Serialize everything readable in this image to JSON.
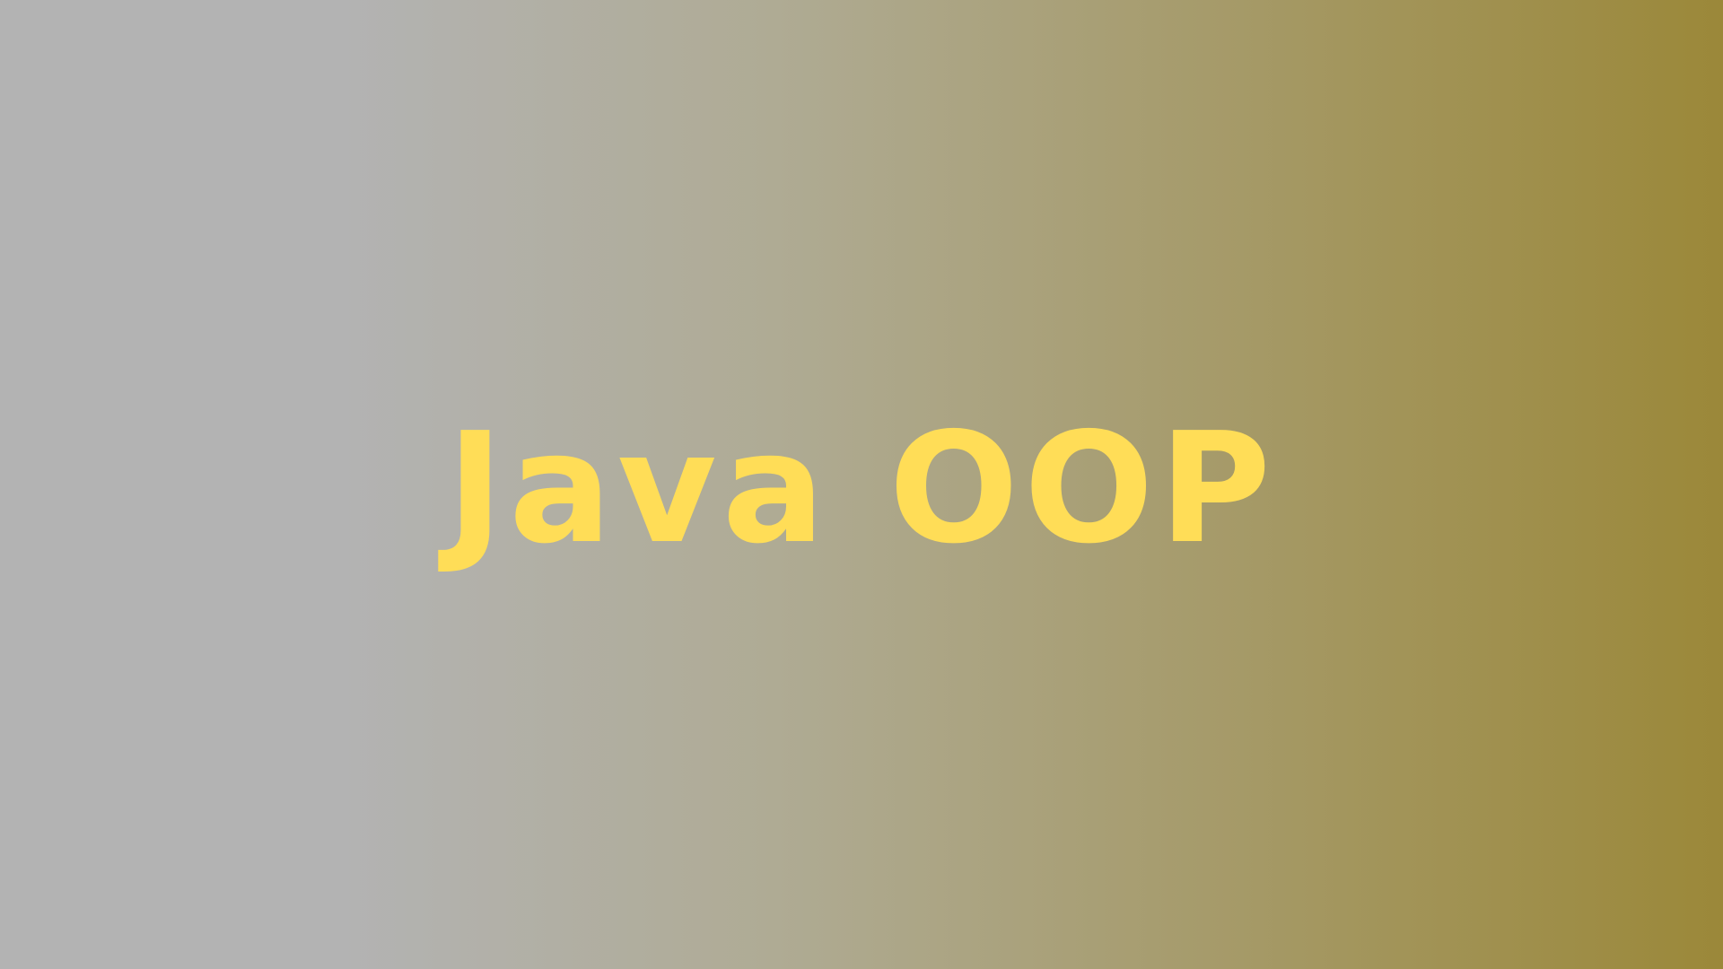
{
  "slide": {
    "title": "Java OOP",
    "colors": {
      "title": "#ffdd57",
      "background_left": "#b3b3b3",
      "background_right": "#9b8839"
    }
  }
}
